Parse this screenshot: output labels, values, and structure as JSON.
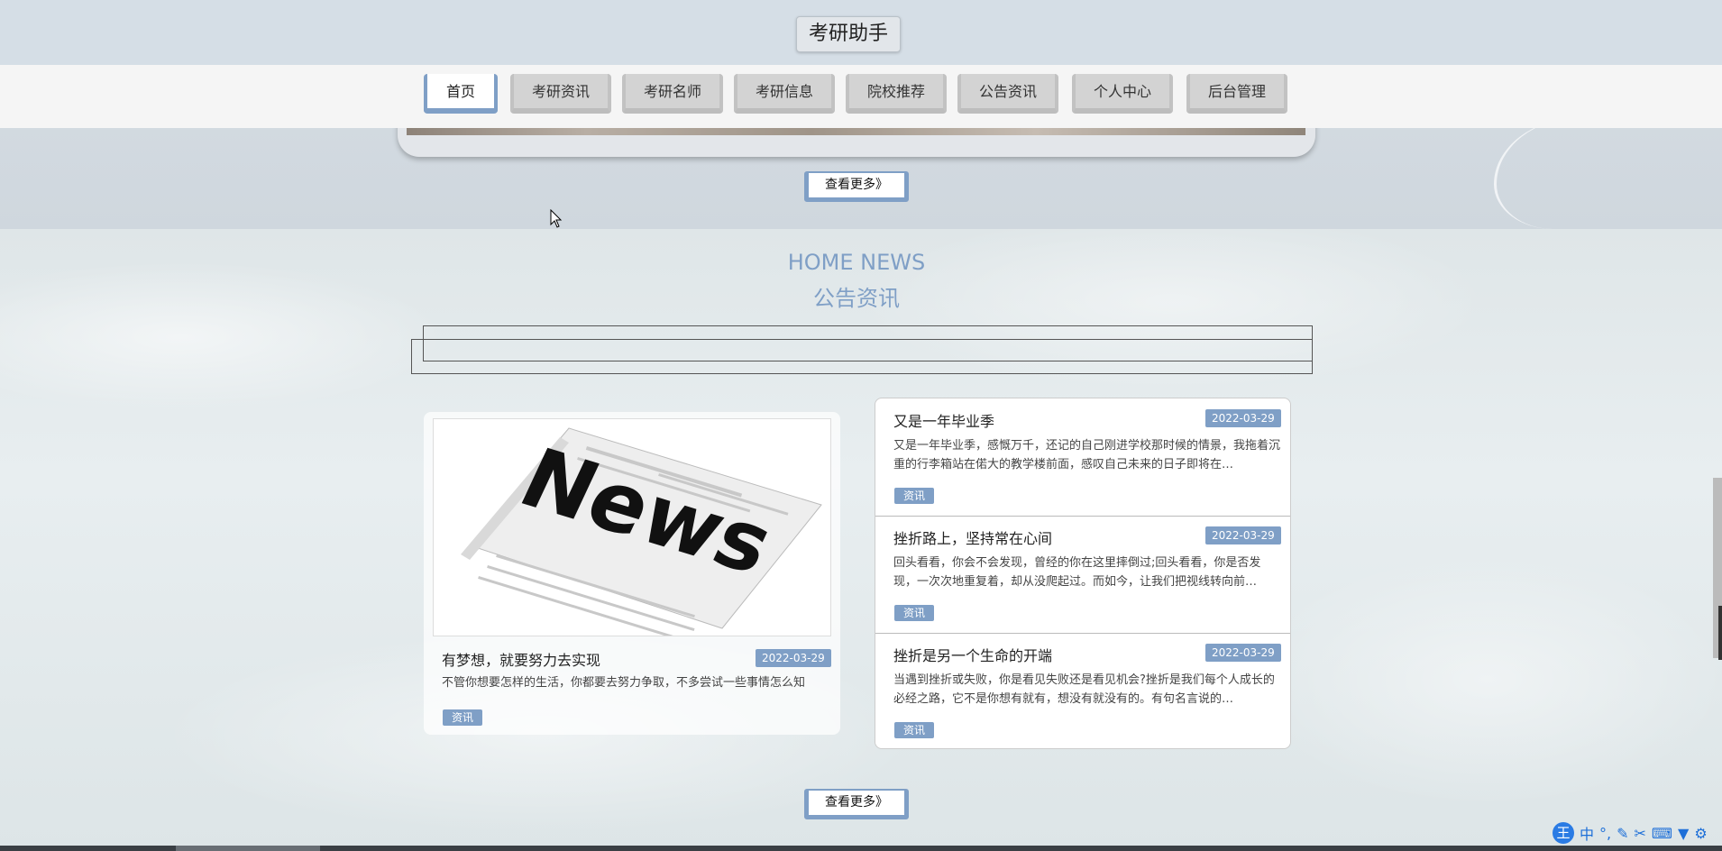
{
  "header": {
    "brand": "考研助手"
  },
  "nav": {
    "items": [
      {
        "label": "首页",
        "active": true
      },
      {
        "label": "考研资讯",
        "active": false
      },
      {
        "label": "考研名师",
        "active": false
      },
      {
        "label": "考研信息",
        "active": false
      },
      {
        "label": "院校推荐",
        "active": false
      },
      {
        "label": "公告资讯",
        "active": false
      },
      {
        "label": "个人中心",
        "active": false
      },
      {
        "label": "后台管理",
        "active": false
      }
    ]
  },
  "hero": {
    "more_label": "查看更多》"
  },
  "news_section": {
    "title_en": "HOME NEWS",
    "title_cn": "公告资讯",
    "featured": {
      "image_text": "News",
      "title": "有梦想，就要努力去实现",
      "date": "2022-03-29",
      "desc": "不管你想要怎样的生活，你都要去努力争取，不多尝试一些事情怎么知",
      "tag": "资讯"
    },
    "list": [
      {
        "title": "又是一年毕业季",
        "date": "2022-03-29",
        "desc": "又是一年毕业季，感慨万千，还记的自己刚进学校那时候的情景，我拖着沉重的行李箱站在偌大的教学楼前面，感叹自己未来的日子即将在…",
        "tag": "资讯"
      },
      {
        "title": "挫折路上，坚持常在心间",
        "date": "2022-03-29",
        "desc": "回头看看，你会不会发现，曾经的你在这里摔倒过;回头看看，你是否发现，一次次地重复着，却从没爬起过。而如今，让我们把视线转向前…",
        "tag": "资讯"
      },
      {
        "title": "挫折是另一个生命的开端",
        "date": "2022-03-29",
        "desc": "当遇到挫折或失败，你是看见失败还是看见机会?挫折是我们每个人成长的必经之路，它不是你想有就有，想没有就没有的。有句名言说的…",
        "tag": "资讯"
      }
    ],
    "more_label": "查看更多》"
  },
  "ime": {
    "logo": "王",
    "mode": "中"
  },
  "colors": {
    "accent": "#7f9fc6",
    "header_bg": "#d5dee6"
  }
}
